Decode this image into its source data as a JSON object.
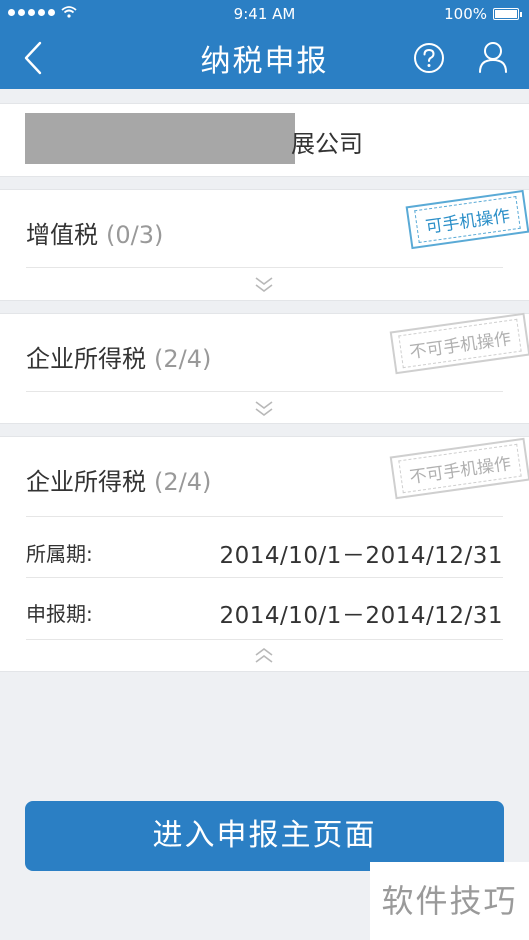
{
  "status_bar": {
    "time": "9:41 AM",
    "battery": "100%"
  },
  "nav": {
    "title": "纳税申报",
    "back_icon": "chevron-left-icon",
    "help_icon": "question-circle-icon",
    "user_icon": "user-icon"
  },
  "company": {
    "name_suffix": "展公司"
  },
  "cards": [
    {
      "title": "增值税",
      "count": "(0/3)",
      "stamp": "可手机操作",
      "expanded": false
    },
    {
      "title": "企业所得税",
      "count": "(2/4)",
      "stamp": "不可手机操作",
      "expanded": false
    },
    {
      "title": "企业所得税",
      "count": "(2/4)",
      "stamp": "不可手机操作",
      "expanded": true,
      "rows": [
        {
          "label": "所属期:",
          "value": "2014/10/1－2014/12/31"
        },
        {
          "label": "申报期:",
          "value": "2014/10/1－2014/12/31"
        }
      ]
    }
  ],
  "main_button": {
    "label": "进入申报主页面"
  },
  "watermark": "软件技巧",
  "colors": {
    "brand": "#2b7fc4",
    "stamp_active": "#2b8fc8",
    "stamp_inactive": "#b0b0b0"
  }
}
